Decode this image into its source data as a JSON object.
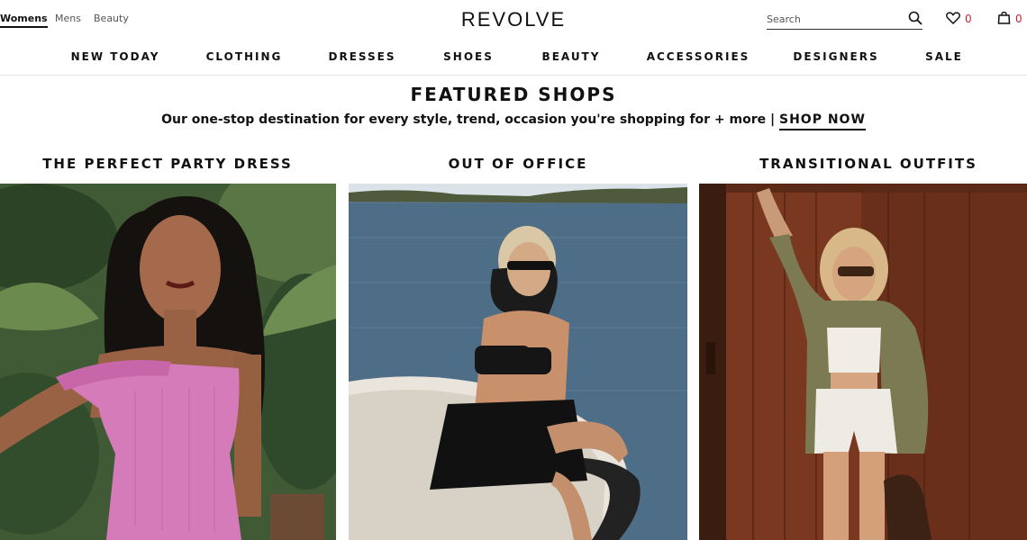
{
  "header": {
    "genders": [
      "Womens",
      "Mens",
      "Beauty"
    ],
    "active_gender": "Womens",
    "logo": "REVOLVE",
    "search": {
      "placeholder": "Search"
    },
    "wishlist_count": "0",
    "bag_count": "0",
    "icons": [
      "search-icon",
      "heart-icon",
      "shopping-bag-icon"
    ],
    "accent_color": "#c0223b"
  },
  "nav": {
    "items": [
      "NEW TODAY",
      "CLOTHING",
      "DRESSES",
      "SHOES",
      "BEAUTY",
      "ACCESSORIES",
      "DESIGNERS",
      "SALE"
    ]
  },
  "featured": {
    "title": "FEATURED SHOPS",
    "subtitle": "Our one-stop destination for every style, trend, occasion you're shopping for + more |",
    "cta": "SHOP NOW"
  },
  "shops": [
    {
      "title": "THE PERFECT PARTY DRESS",
      "image": "woman in pink dress among tropical plants"
    },
    {
      "title": "OUT OF OFFICE",
      "image": "woman in black on a boat by the water"
    },
    {
      "title": "TRANSITIONAL OUTFITS",
      "image": "woman in olive jacket and white lace set by wood door"
    }
  ]
}
